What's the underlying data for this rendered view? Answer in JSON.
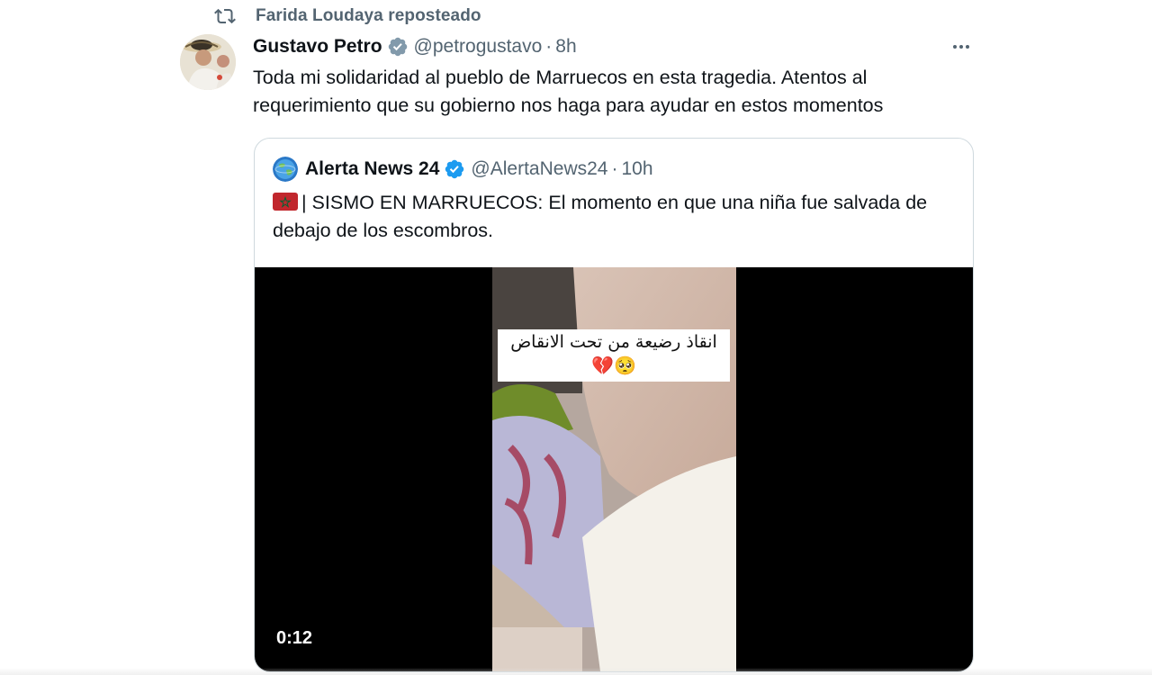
{
  "repost": {
    "text": "Farida Loudaya reposteado",
    "icon": "repost-icon"
  },
  "tweet": {
    "display_name": "Gustavo Petro",
    "verified": "gray",
    "handle": "@petrogustavo",
    "separator": "·",
    "time": "8h",
    "more_icon": "more-horizontal-icon",
    "text": "Toda mi solidaridad al pueblo de Marruecos en esta tragedia. Atentos al requerimiento que su gobierno nos haga para ayudar en estos momentos"
  },
  "quote": {
    "display_name": "Alerta News 24",
    "verified": "blue",
    "handle": "@AlertaNews24",
    "separator": "·",
    "time": "10h",
    "flag_icon": "morocco-flag-icon",
    "text": "| SISMO EN MARRUECOS: El momento en que una niña fue salvada de debajo de los escombros.",
    "video": {
      "caption_line1": "انقاذ رضيعة من تحت الانقاض",
      "caption_emojis": "💔🥺",
      "duration": "0:12"
    }
  },
  "colors": {
    "text_primary": "#0f1419",
    "text_secondary": "#536471",
    "verified_blue": "#1d9bf0",
    "verified_gray": "#829aab",
    "border": "#cfd9de"
  }
}
